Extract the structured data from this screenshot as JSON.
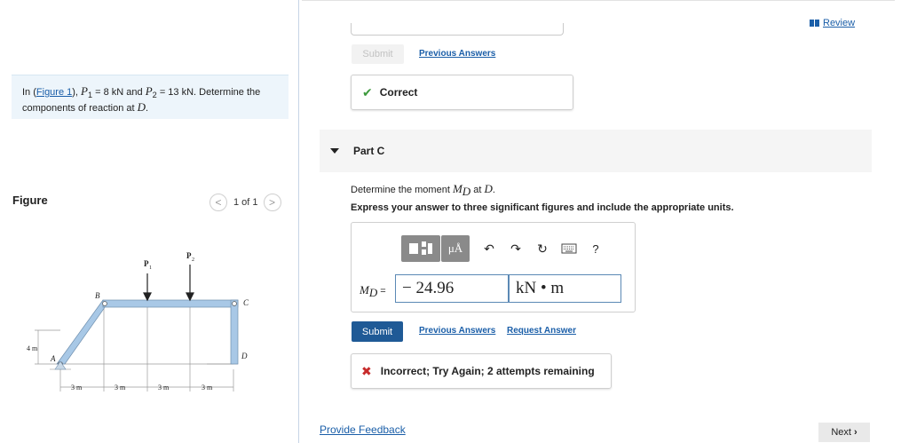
{
  "problem": {
    "text_prefix": "In (",
    "figure_link": "Figure 1",
    "text_mid": "), ",
    "p1_symbol": "P",
    "p1_sub": "1",
    "p1_value": " = 8 kN and ",
    "p2_symbol": "P",
    "p2_sub": "2",
    "p2_value": " = 13 kN. Determine the components of reaction at ",
    "point": "D",
    "end": "."
  },
  "figure": {
    "title": "Figure",
    "pager": {
      "label": "1 of 1",
      "prev": "<",
      "next": ">"
    },
    "labels": {
      "p1": "P",
      "p1_sub": "1",
      "p2": "P",
      "p2_sub": "2",
      "b": "B",
      "c": "C",
      "a": "A",
      "d": "D",
      "height": "4 m",
      "dims": [
        "3 m",
        "3 m",
        "3 m",
        "3 m"
      ]
    }
  },
  "header": {
    "review_label": "Review"
  },
  "part_b": {
    "submit_label": "Submit",
    "previous_answers_label": "Previous Answers",
    "result_label": "Correct"
  },
  "part_c": {
    "title": "Part C",
    "question_prefix": "Determine the moment ",
    "moment_symbol": "M",
    "moment_sub": "D",
    "question_mid": " at ",
    "question_point": "D",
    "question_end": ".",
    "instruction": "Express your answer to three significant figures and include the appropriate units.",
    "toolbar": {
      "units_label": "μÅ",
      "help": "?"
    },
    "answer_label_symbol": "M",
    "answer_label_sub": "D",
    "answer_label_eq": " =",
    "answer_value": "− 24.96",
    "answer_unit": "kN • m",
    "submit_label": "Submit",
    "previous_answers_label": "Previous Answers",
    "request_answer_label": "Request Answer",
    "result_label": "Incorrect; Try Again; 2 attempts remaining"
  },
  "footer": {
    "feedback_label": "Provide Feedback",
    "next_label": "Next"
  },
  "colors": {
    "link": "#1a5ea8",
    "submit": "#1f5a96",
    "correct": "#3d9a3d",
    "incorrect": "#c72b2b",
    "frame": "#a8c8e6"
  }
}
